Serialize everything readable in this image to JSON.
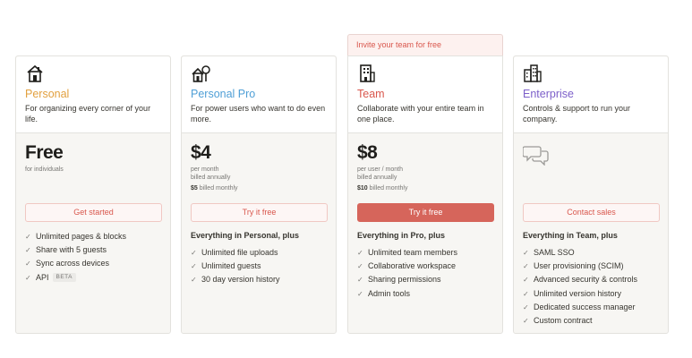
{
  "colors": {
    "personal": "#e2a03f",
    "personal_pro": "#4f9fd6",
    "team": "#d9574d",
    "enterprise": "#7c5fc9"
  },
  "banner": "Invite your team for free",
  "plans": [
    {
      "name": "Personal",
      "icon": "house-icon",
      "description": "For organizing every corner of your life.",
      "price": "Free",
      "price_note": [
        "for individuals"
      ],
      "billed": "",
      "cta": "Get started",
      "features_header": "",
      "features": [
        "Unlimited pages & blocks",
        "Share with 5 guests",
        "Sync across devices",
        "API"
      ],
      "badge": "BETA"
    },
    {
      "name": "Personal Pro",
      "icon": "house-with-tree-icon",
      "description": "For power users who want to do even more.",
      "price": "$4",
      "price_note": [
        "per month",
        "billed annually"
      ],
      "billed_amount": "$5",
      "billed_suffix": "billed monthly",
      "cta": "Try it free",
      "features_header": "Everything in Personal, plus",
      "features": [
        "Unlimited file uploads",
        "Unlimited guests",
        "30 day version history"
      ]
    },
    {
      "name": "Team",
      "icon": "office-building-icon",
      "description": "Collaborate with your entire team in one place.",
      "price": "$8",
      "price_note": [
        "per user / month",
        "billed annually"
      ],
      "billed_amount": "$10",
      "billed_suffix": "billed monthly",
      "cta": "Try it free",
      "features_header": "Everything in Pro, plus",
      "features": [
        "Unlimited team members",
        "Collaborative workspace",
        "Sharing permissions",
        "Admin tools"
      ]
    },
    {
      "name": "Enterprise",
      "icon": "city-buildings-icon",
      "description": "Controls & support to run your company.",
      "price_icon": "chat-bubbles-icon",
      "cta": "Contact sales",
      "features_header": "Everything in Team, plus",
      "features": [
        "SAML SSO",
        "User provisioning (SCIM)",
        "Advanced security & controls",
        "Unlimited version history",
        "Dedicated success manager",
        "Custom contract"
      ]
    }
  ]
}
